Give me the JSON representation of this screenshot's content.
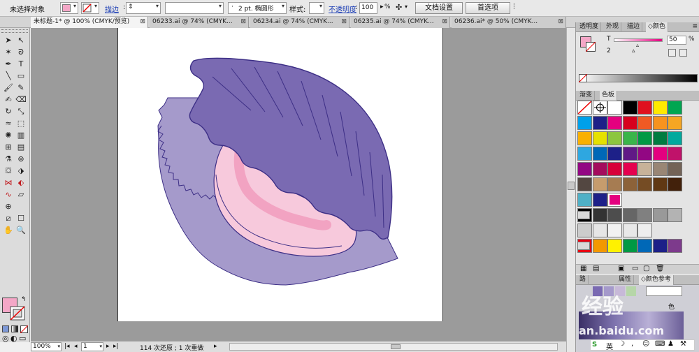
{
  "control_bar": {
    "selection_label": "未选择对象",
    "fill_color": "#f4a7c7",
    "stroke_label": "描边",
    "weight_value": "",
    "stroke_width_label": "2 pt. 椭圆形",
    "style_label": "样式:",
    "opacity_label": "不透明度",
    "opacity_value": "100",
    "opacity_unit": "%",
    "doc_setup_button": "文档设置",
    "preferences_button": "首选项"
  },
  "tabs": [
    {
      "label": "未标题-1* @ 100% (CMYK/预览)"
    },
    {
      "label": "06233.ai @ 74% (CMYK..."
    },
    {
      "label": "06234.ai @ 74% (CMYK..."
    },
    {
      "label": "06235.ai @ 74% (CMYK..."
    },
    {
      "label": "06236.ai* @ 50% (CMYK..."
    }
  ],
  "toolbox": {
    "icons": [
      "selection-tool-icon",
      "direct-selection-tool-icon",
      "magic-wand-tool-icon",
      "lasso-tool-icon",
      "pen-tool-icon",
      "type-tool-icon",
      "line-tool-icon",
      "rectangle-tool-icon",
      "paintbrush-tool-icon",
      "pencil-tool-icon",
      "blob-brush-tool-icon",
      "eraser-tool-icon",
      "rotate-tool-icon",
      "scale-tool-icon",
      "warp-tool-icon",
      "free-transform-tool-icon",
      "symbol-sprayer-tool-icon",
      "graph-tool-icon",
      "mesh-tool-icon",
      "gradient-tool-icon",
      "eyedropper-tool-icon",
      "blend-tool-icon",
      "live-paint-tool-icon",
      "live-paint-selection-tool-icon",
      "width-tool-icon",
      "shape-builder-tool-icon",
      "curve-tool-icon",
      "perspective-tool-icon",
      "crosshair-tool-icon",
      "slice-tool-icon",
      "artboard-tool-icon",
      "hand-tool-icon",
      "zoom-tool-icon"
    ],
    "fill_color": "#f4a7c7",
    "stroke_color": "#ffffff"
  },
  "status_bar": {
    "zoom": "100%",
    "page": "1",
    "history_text": "114 次还原 ; 1 次重做"
  },
  "color_panel": {
    "tabs": [
      "透明度",
      "外观",
      "描边",
      "颜色"
    ],
    "active_tab": "颜色",
    "channel_label": "T",
    "channel_value": "50",
    "small_value": "2",
    "fill_color": "#f4a7c7"
  },
  "swatches_panel": {
    "tabs": [
      "渐变",
      "色板"
    ],
    "active_tab": "色板",
    "rows": [
      [
        "none",
        "registration",
        "#ffffff",
        "#000000",
        "#e0101e",
        "#ffea00",
        "#00a651"
      ],
      [
        "#00a0e9",
        "#1d2088",
        "#e4007f",
        "#d7001d",
        "#ef5a24",
        "#f7931e",
        "#f5a623"
      ],
      [
        "#f9b000",
        "#e5e100",
        "#8cc63f",
        "#3ab54a",
        "#009944",
        "#007c41",
        "#00a99d"
      ],
      [
        "#2ea7e0",
        "#0068b7",
        "#1d2088",
        "#601986",
        "#920783",
        "#e4007f",
        "#c0126a"
      ],
      [
        "#920783",
        "#a40b5d",
        "#d7003a",
        "#e5004f",
        "#c7b299",
        "#998675",
        "#736357"
      ],
      [
        "#534741",
        "#c69c6d",
        "#a67c52",
        "#8c6239",
        "#754c24",
        "#603813",
        "#42210b"
      ],
      [
        "#4fb0c6",
        "#1d2088",
        "#e4007f"
      ],
      [
        "#000000",
        "#333333",
        "#4d4d4d",
        "#666666",
        "#808080",
        "#999999",
        "#b3b3b3"
      ],
      [
        "#cccccc",
        "#e6e6e6",
        "#f2f2f2",
        "#e8e8e8",
        "#eeeeee"
      ],
      [
        "#e60012",
        "#f39800",
        "#fff100",
        "#009944",
        "#0068b7",
        "#1d2088",
        "#7d3a8c"
      ]
    ]
  },
  "bottom_panel": {
    "tabs": [
      "路",
      "属性",
      "颜色参考"
    ],
    "label_suffix": "色"
  },
  "watermark": {
    "text": "经验",
    "url": "an.baidu.com",
    "ime": "英"
  },
  "artwork": {
    "shell_top_color": "#7a6ab2",
    "shell_back_color": "#a59acb",
    "pearl_body_color": "#f7c9dc",
    "pearl_inner_color": "#f2a3c2",
    "outline_color": "#3d2f86"
  }
}
